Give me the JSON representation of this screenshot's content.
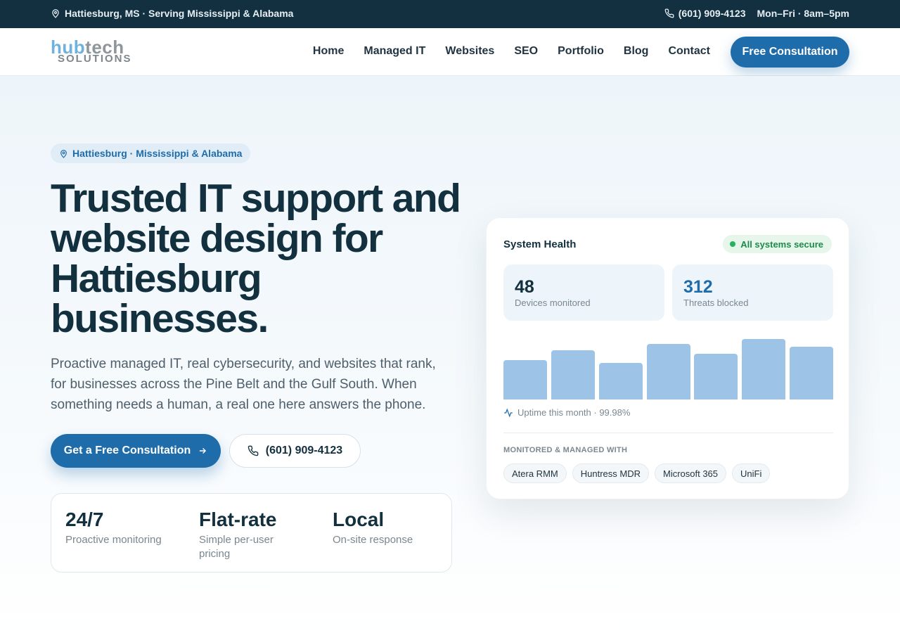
{
  "topbar": {
    "location": "Hattiesburg, MS · Serving Mississippi & Alabama",
    "phone": "(601) 909-4123",
    "hours": "Mon–Fri · 8am–5pm"
  },
  "nav": {
    "logo_top_a": "hub",
    "logo_top_b": "tech",
    "logo_bottom": "SOLUTIONS",
    "items": [
      "Home",
      "Managed IT",
      "Websites",
      "SEO",
      "Portfolio",
      "Blog",
      "Contact"
    ],
    "cta": "Free Consultation"
  },
  "hero": {
    "pill": "Hattiesburg · Mississippi & Alabama",
    "headline": "Trusted IT support and website design for Hattiesburg businesses.",
    "subheadline": "Proactive managed IT, real cybersecurity, and websites that rank, for businesses across the Pine Belt and the Gulf South. When something needs a human, a real one here answers the phone.",
    "primary_cta": "Get a Free Consultation",
    "secondary_cta": "(601) 909-4123",
    "stats": [
      {
        "value": "24/7",
        "label": "Proactive monitoring"
      },
      {
        "value": "Flat-rate",
        "label": "Simple per-user pricing"
      },
      {
        "value": "Local",
        "label": "On-site response"
      }
    ]
  },
  "card": {
    "title": "System Health",
    "status": "All systems secure",
    "metrics": [
      {
        "value": "48",
        "label": "Devices monitored",
        "color": "#13303f"
      },
      {
        "value": "312",
        "label": "Threats blocked",
        "color": "#1f6cab"
      }
    ],
    "bar_levels": [
      0.64,
      0.79,
      0.59,
      0.9,
      0.74,
      0.98,
      0.85
    ],
    "uptime": "Uptime this month · 99.98%",
    "managed_label": "MONITORED & MANAGED WITH",
    "tools": [
      "Atera RMM",
      "Huntress MDR",
      "Microsoft 365",
      "UniFi"
    ]
  },
  "colors": {
    "brand": "#1f6cab",
    "dark": "#13303f",
    "success": "#24b35e",
    "bar": "#9dc3e6"
  }
}
